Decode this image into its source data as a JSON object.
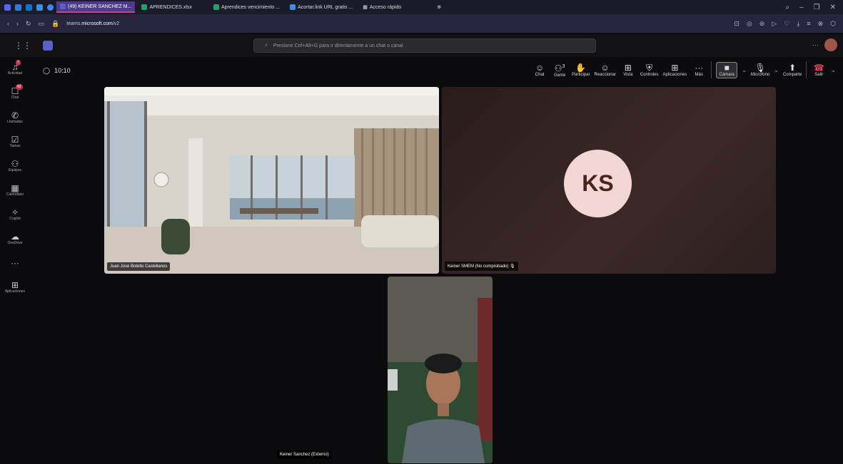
{
  "browser": {
    "tabs": [
      {
        "label": "(49) KEINER SANCHEZ M..."
      },
      {
        "label": "APRENDICES.xlsx"
      },
      {
        "label": "Aprendices vencimiento ..."
      },
      {
        "label": "Acortar.link URL gratis ..."
      },
      {
        "label": "Acceso rápido"
      }
    ],
    "url_prefix": "teams.",
    "url_domain": "microsoft.com",
    "url_path": "/v2"
  },
  "teams": {
    "search_placeholder": "Presione Ctrl+Alt+G para ir directamente a un chat o canal",
    "more": "···"
  },
  "rail": {
    "items": [
      {
        "label": "Actividad",
        "badge": "7"
      },
      {
        "label": "Chat",
        "badge": "42"
      },
      {
        "label": "Llamadas"
      },
      {
        "label": "Tareas"
      },
      {
        "label": "Equipos"
      },
      {
        "label": "Calendario"
      },
      {
        "label": "Copilot"
      },
      {
        "label": "OneDrive"
      },
      {
        "label": "Aplicaciones"
      }
    ],
    "more": "···"
  },
  "meeting": {
    "timer": "10:10",
    "controls": {
      "chat": "Chat",
      "people": "Gente",
      "people_count": "3",
      "raise": "Participar",
      "react": "Reaccionar",
      "view": "Vista",
      "controls": "Controles",
      "apps": "Aplicaciones",
      "more": "Más",
      "camera": "Cámara",
      "mic": "Micrófono",
      "share": "Comparte",
      "leave": "Salir"
    },
    "participants": [
      {
        "name": "Juan José Botello Castellanos"
      },
      {
        "name": "Keiner SMEM (No comprobado)",
        "initials": "KS"
      },
      {
        "name": "Keiner Sanchez (Externo)"
      }
    ]
  }
}
